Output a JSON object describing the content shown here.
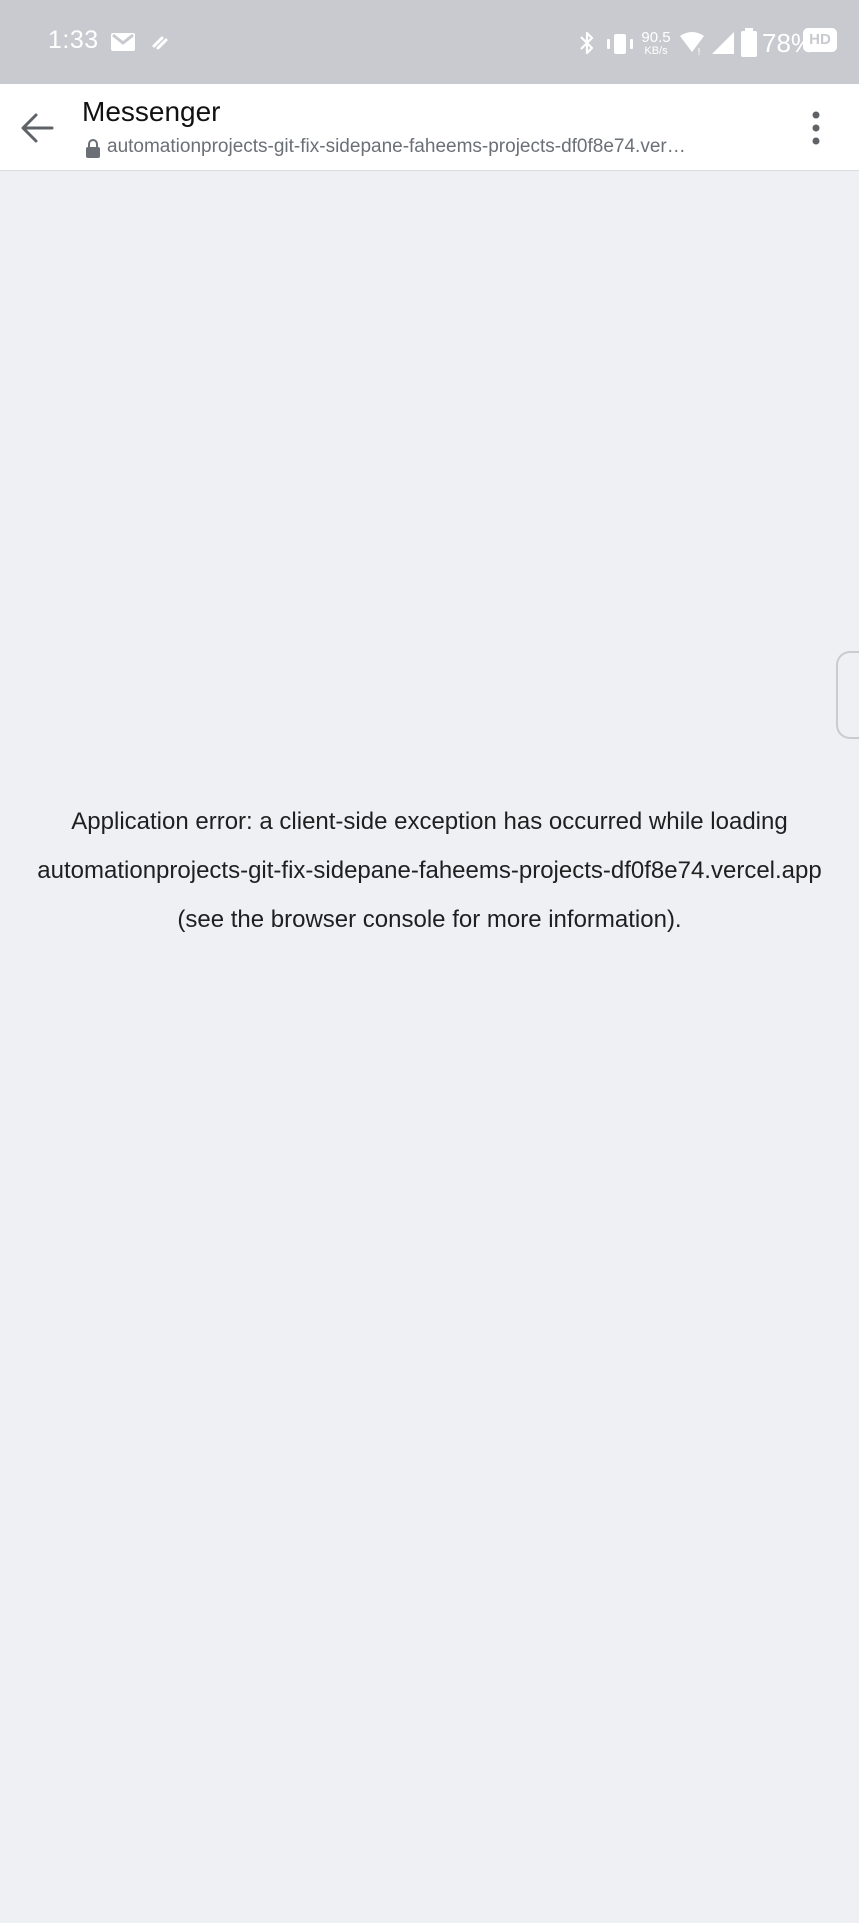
{
  "status_bar": {
    "time": "1:33",
    "left_icons": [
      "gmail-icon",
      "link-icon"
    ],
    "right_icons": [
      "bluetooth-icon",
      "vibrate-icon",
      "wifi-icon",
      "signal-icon",
      "battery-icon"
    ],
    "network_speed_value": "90.5",
    "network_speed_unit": "KB/s",
    "battery_percent": "78%",
    "hd_badge": "HD"
  },
  "toolbar": {
    "title": "Messenger",
    "url": "automationprojects-git-fix-sidepane-faheems-projects-df0f8e74.ver…",
    "back_icon": "back-arrow-icon",
    "menu_icon": "more-vertical-icon"
  },
  "error": {
    "line1": "Application error: a client-side exception has occurred while loading",
    "line2": "automationprojects-git-fix-sidepane-faheems-projects-df0f8e74.vercel.app",
    "line3": "(see the browser console for more information)."
  },
  "colors": {
    "status_bar_bg": "#c8cacf",
    "toolbar_bg": "#ffffff",
    "page_bg": "#eff0f4",
    "text_primary": "#1f1f1f",
    "url_text": "#6b6f76"
  }
}
